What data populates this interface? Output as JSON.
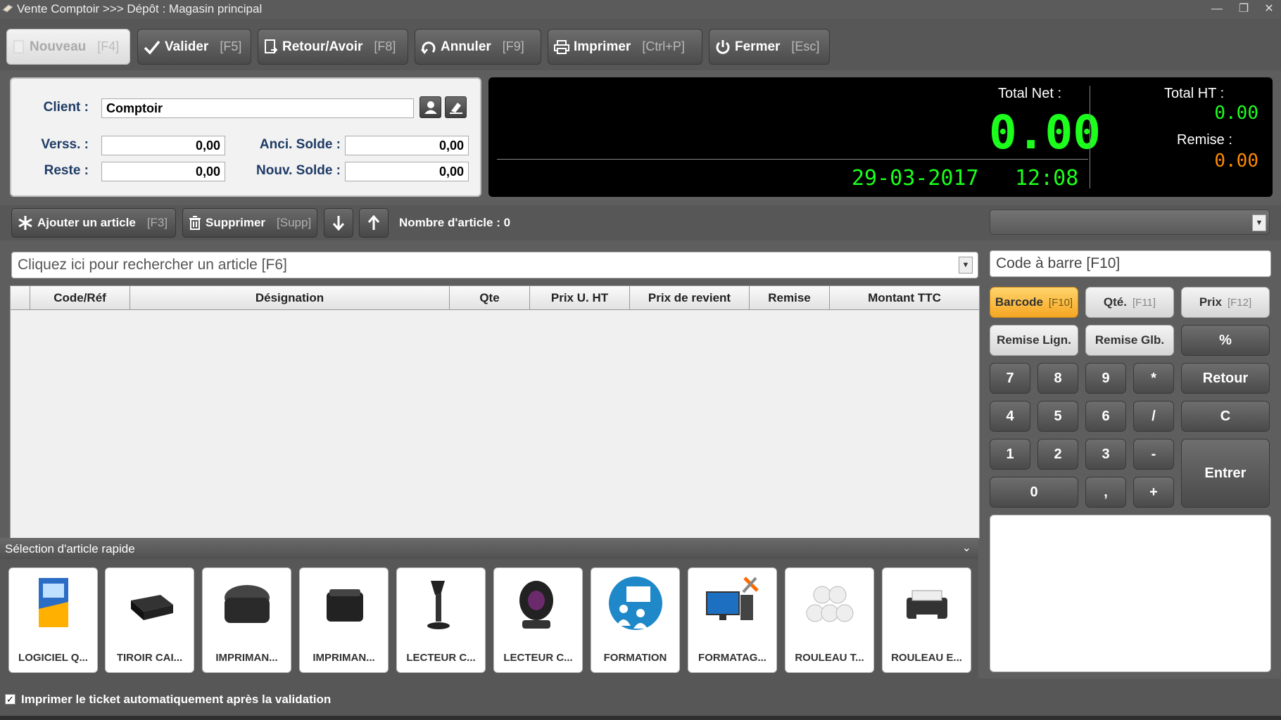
{
  "window": {
    "title": "Vente Comptoir >>> Dépôt : Magasin principal",
    "minimize": "—",
    "restore": "❐",
    "close": "✕"
  },
  "toolbar": {
    "nouveau": "Nouveau",
    "nouveau_key": "[F4]",
    "valider": "Valider",
    "valider_key": "[F5]",
    "retour": "Retour/Avoir",
    "retour_key": "[F8]",
    "annuler": "Annuler",
    "annuler_key": "[F9]",
    "imprimer": "Imprimer",
    "imprimer_key": "[Ctrl+P]",
    "fermer": "Fermer",
    "fermer_key": "[Esc]"
  },
  "client": {
    "client_label": "Client :",
    "client_value": "Comptoir",
    "verss_label": "Verss. :",
    "verss_value": "0,00",
    "reste_label": "Reste :",
    "reste_value": "0,00",
    "anci_label": "Anci. Solde :",
    "anci_value": "0,00",
    "nouv_label": "Nouv. Solde :",
    "nouv_value": "0,00"
  },
  "display": {
    "total_net_label": "Total Net :",
    "total_net_value": "0.00",
    "date": "29-03-2017",
    "time": "12:08",
    "total_ht_label": "Total HT :",
    "total_ht_value": "0.00",
    "remise_label": "Remise :",
    "remise_value": "0.00"
  },
  "articles_bar": {
    "ajouter": "Ajouter un article",
    "ajouter_key": "[F3]",
    "supprimer": "Supprimer",
    "supprimer_key": "[Supp]",
    "count_label": "Nombre d'article : 0"
  },
  "search": {
    "placeholder": "Cliquez ici pour rechercher un article [F6]",
    "barcode_placeholder": "Code à barre [F10]"
  },
  "grid": {
    "columns": [
      "",
      "Code/Réf",
      "Désignation",
      "Qte",
      "Prix U. HT",
      "Prix de revient",
      "Remise",
      "Montant TTC"
    ]
  },
  "keypad": {
    "barcode": "Barcode",
    "barcode_key": "[F10]",
    "qte": "Qté.",
    "qte_key": "[F11]",
    "prix": "Prix",
    "prix_key": "[F12]",
    "remise_lign": "Remise Lign.",
    "remise_glb": "Remise Glb.",
    "percent": "%",
    "k7": "7",
    "k8": "8",
    "k9": "9",
    "kmul": "*",
    "retour": "Retour",
    "k4": "4",
    "k5": "5",
    "k6": "6",
    "kdiv": "/",
    "clear": "C",
    "k1": "1",
    "k2": "2",
    "k3": "3",
    "kminus": "-",
    "entrer": "Entrer",
    "k0": "0",
    "kcomma": ",",
    "kplus": "+"
  },
  "quick": {
    "title": "Sélection d'article rapide",
    "items": [
      "LOGICIEL Q...",
      "TIROIR CAI...",
      "IMPRIMAN...",
      "IMPRIMAN...",
      "LECTEUR C...",
      "LECTEUR C...",
      "FORMATION",
      "FORMATAG...",
      "ROULEAU T...",
      "ROULEAU E..."
    ]
  },
  "footer": {
    "auto_print": "Imprimer le ticket automatiquement après la validation",
    "check_mark": "✓"
  },
  "colors": {
    "display_green": "#1cff1c",
    "display_orange": "#ff8a00",
    "active_key": "#f5a623"
  }
}
